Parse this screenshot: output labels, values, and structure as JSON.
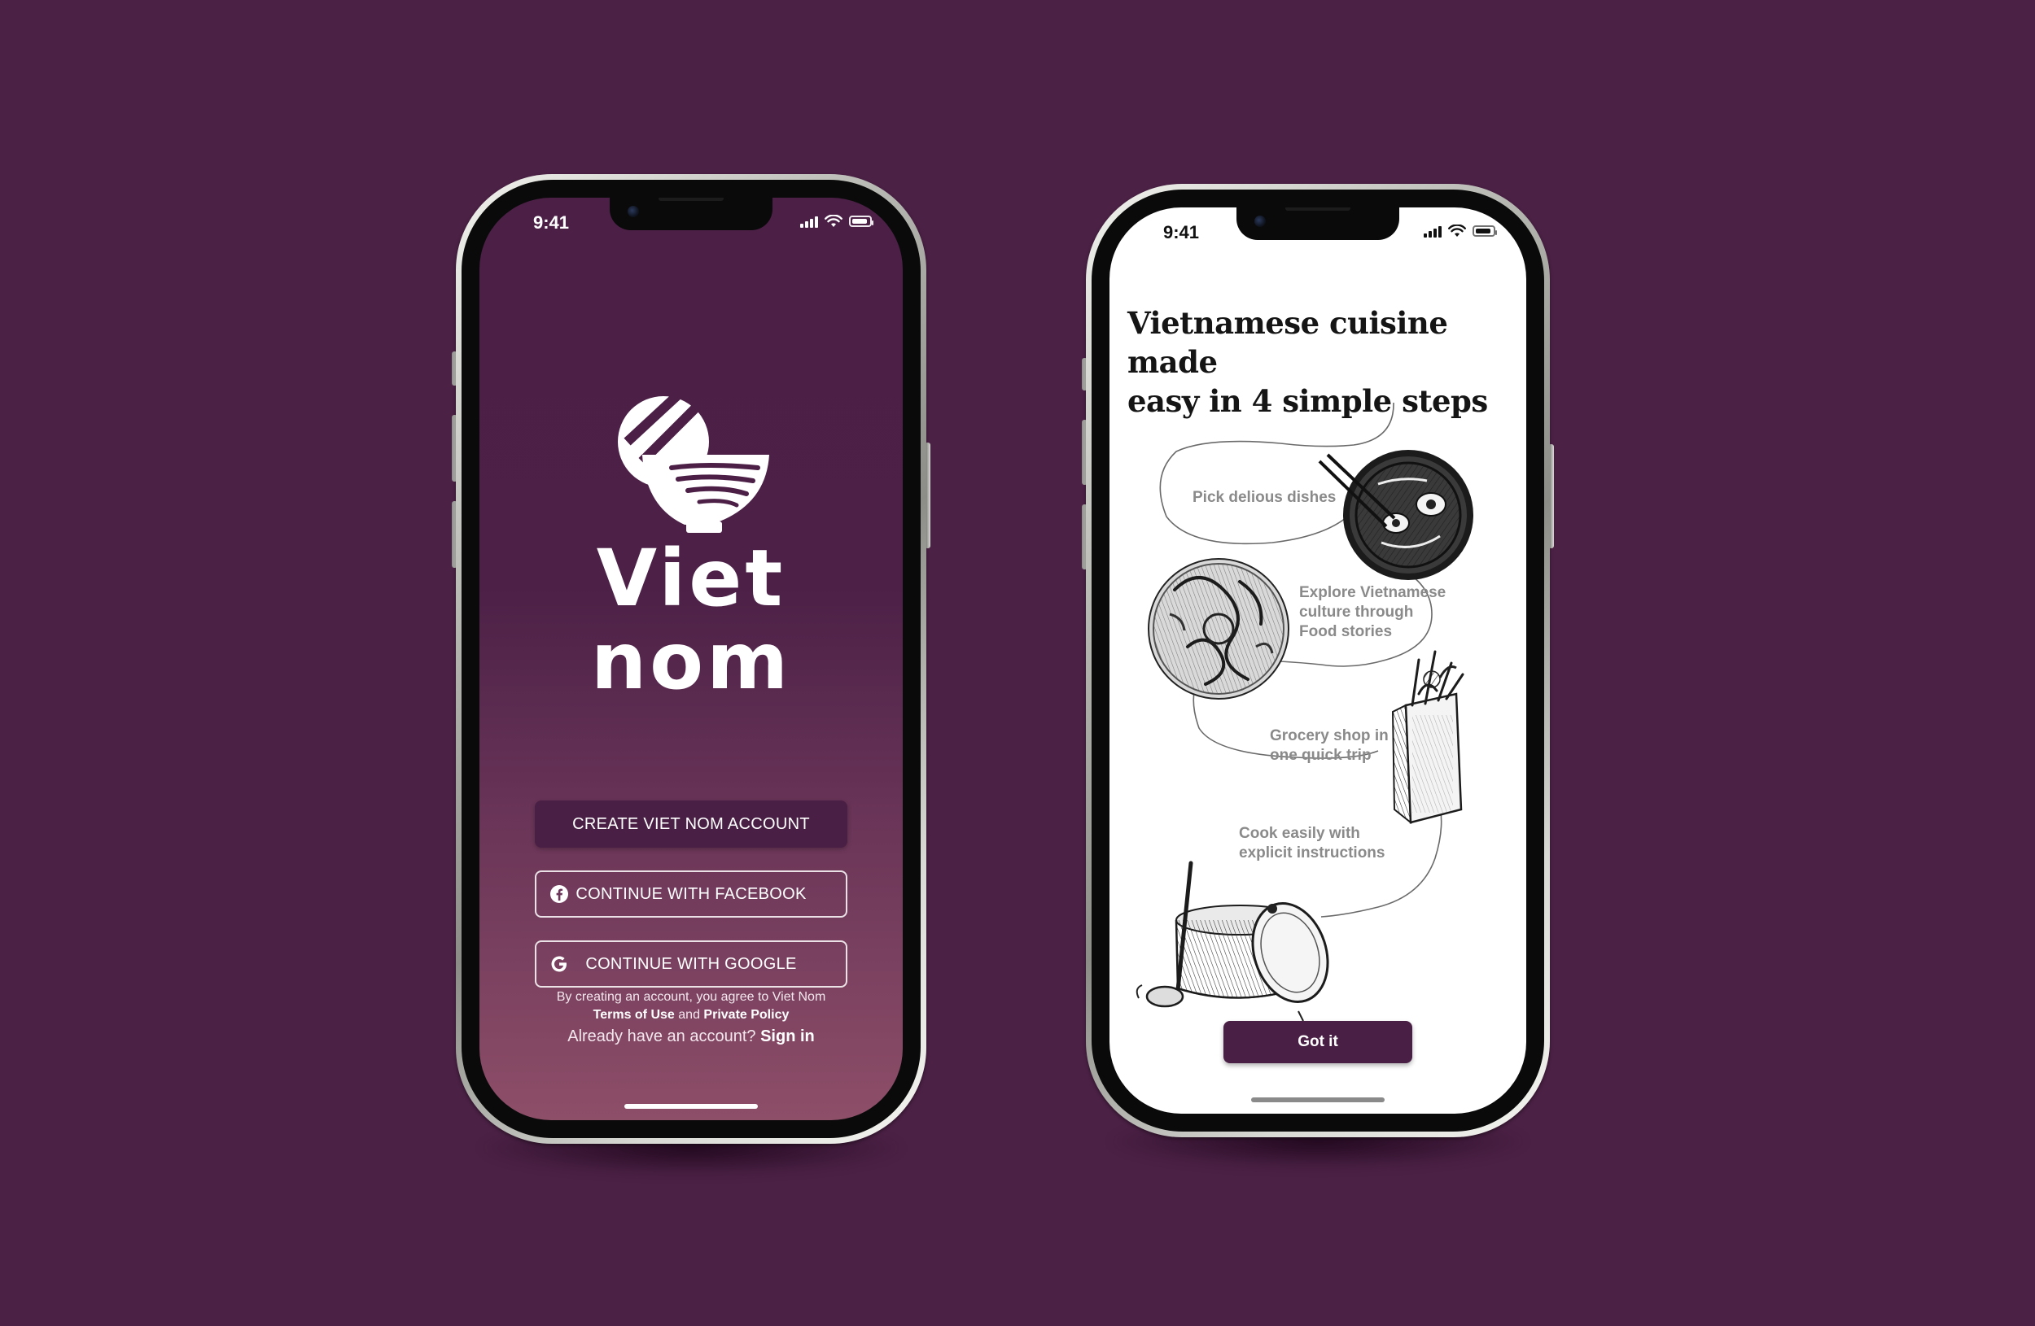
{
  "colors": {
    "background": "#4b2145",
    "brand_plum": "#4a1f45",
    "gradient_bottom": "#8d4e68"
  },
  "left_phone": {
    "status_time": "9:41",
    "brand_logo_text": "Viet Nom",
    "wordmark_line1": "Viet",
    "wordmark_line2": "nom",
    "buttons": {
      "create_account": "CREATE VIET NOM ACCOUNT",
      "facebook": "CONTINUE WITH FACEBOOK",
      "google": "CONTINUE WITH GOOGLE"
    },
    "icons": {
      "facebook": "facebook-icon",
      "google": "google-icon"
    },
    "legal": {
      "prefix": "By creating an account, you agree to Viet Nom",
      "terms": "Terms of Use",
      "and": "and",
      "privacy": "Private Policy"
    },
    "signin": {
      "prompt": "Already have an account?",
      "link": "Sign in"
    }
  },
  "right_phone": {
    "status_time": "9:41",
    "headline_line1": "Vietnamese cuisine made",
    "headline_line2": "easy in 4 simple steps",
    "steps": [
      {
        "line1": "Pick delious dishes",
        "line2": "",
        "line3": "",
        "illustration": "pho-bowl-illustration"
      },
      {
        "line1": "Explore Vietnamese",
        "line2": "culture through",
        "line3": "Food stories",
        "illustration": "dragon-drum-illustration"
      },
      {
        "line1": "Grocery shop in",
        "line2": "one quick trip",
        "line3": "",
        "illustration": "grocery-bag-illustration"
      },
      {
        "line1": "Cook easily with",
        "line2": "explicit instructions",
        "line3": "",
        "illustration": "cooking-pot-illustration"
      }
    ],
    "cta": "Got it"
  }
}
